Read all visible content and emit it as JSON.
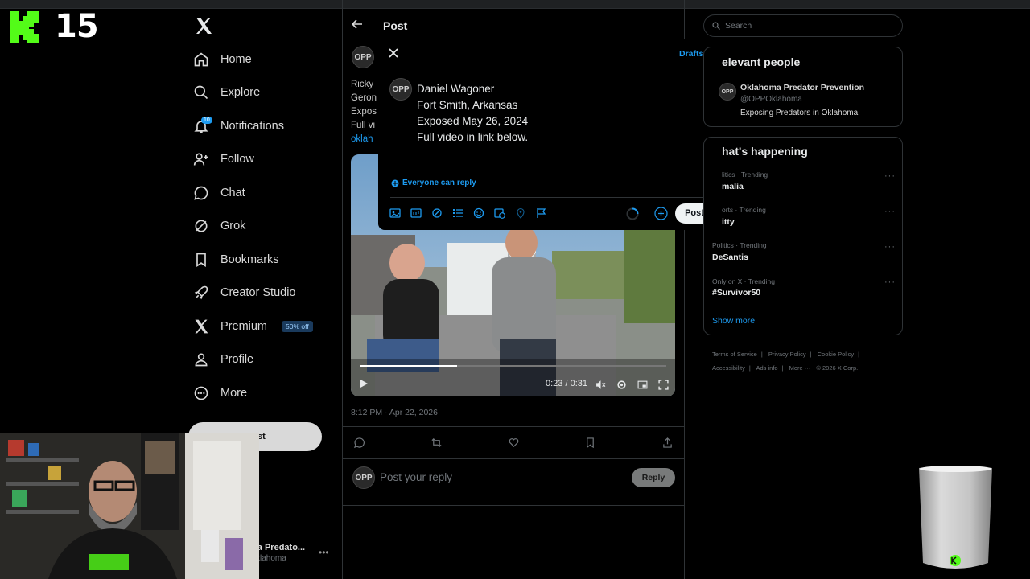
{
  "overlay": {
    "counter": "15"
  },
  "nav": {
    "items": [
      {
        "label": "Home",
        "icon": "home-icon"
      },
      {
        "label": "Explore",
        "icon": "search-icon"
      },
      {
        "label": "Notifications",
        "icon": "bell-icon",
        "badge": "10"
      },
      {
        "label": "Follow",
        "icon": "person-plus-icon"
      },
      {
        "label": "Chat",
        "icon": "chat-icon"
      },
      {
        "label": "Grok",
        "icon": "grok-icon"
      },
      {
        "label": "Bookmarks",
        "icon": "bookmark-icon"
      },
      {
        "label": "Creator Studio",
        "icon": "rocket-icon"
      },
      {
        "label": "Premium",
        "icon": "x-icon",
        "badge": "50% off"
      },
      {
        "label": "Profile",
        "icon": "person-icon"
      },
      {
        "label": "More",
        "icon": "more-circle-icon"
      }
    ],
    "post_button": "st",
    "account_name": "ma Predato...",
    "account_handle": "klahoma"
  },
  "main": {
    "title": "Post",
    "avatar_text": "OPP",
    "tweet_fragments": [
      "Ricky",
      "Geron",
      "Expos",
      "Full vi"
    ],
    "tweet_link": "oklah",
    "video": {
      "time": "0:23 / 0:31"
    },
    "timestamp": "8:12 PM · Apr 22, 2026",
    "reply_placeholder": "Post your reply",
    "reply_button": "Reply"
  },
  "compose": {
    "drafts": "Drafts",
    "lines": [
      "Daniel Wagoner",
      "Fort Smith, Arkansas",
      "Exposed May 26, 2024",
      "Full video in link below."
    ],
    "everyone_can_reply": "Everyone can reply",
    "post_button": "Post"
  },
  "right": {
    "search_placeholder": "Search",
    "relevant_title": "elevant people",
    "relevant_person": {
      "name": "Oklahoma Predator Prevention",
      "handle": "@OPPOklahoma",
      "bio": "Exposing Predators in Oklahoma"
    },
    "happening_title": "hat's happening",
    "trends": [
      {
        "category": "litics · Trending",
        "name": "malia"
      },
      {
        "category": "orts · Trending",
        "name": "itty"
      },
      {
        "category": "Politics · Trending",
        "name": "DeSantis"
      },
      {
        "category": "Only on X · Trending",
        "name": "#Survivor50"
      }
    ],
    "show_more": "Show more",
    "footer": [
      "Terms of Service",
      "|",
      "Privacy Policy",
      "|",
      "Cookie Policy",
      "|",
      "Accessibility",
      "|",
      "Ads info",
      "|",
      "More ···",
      "© 2026 X Corp."
    ]
  },
  "colors": {
    "accent": "#1d9bf0",
    "background": "#000000",
    "border": "#2f3336",
    "muted": "#71767b"
  }
}
